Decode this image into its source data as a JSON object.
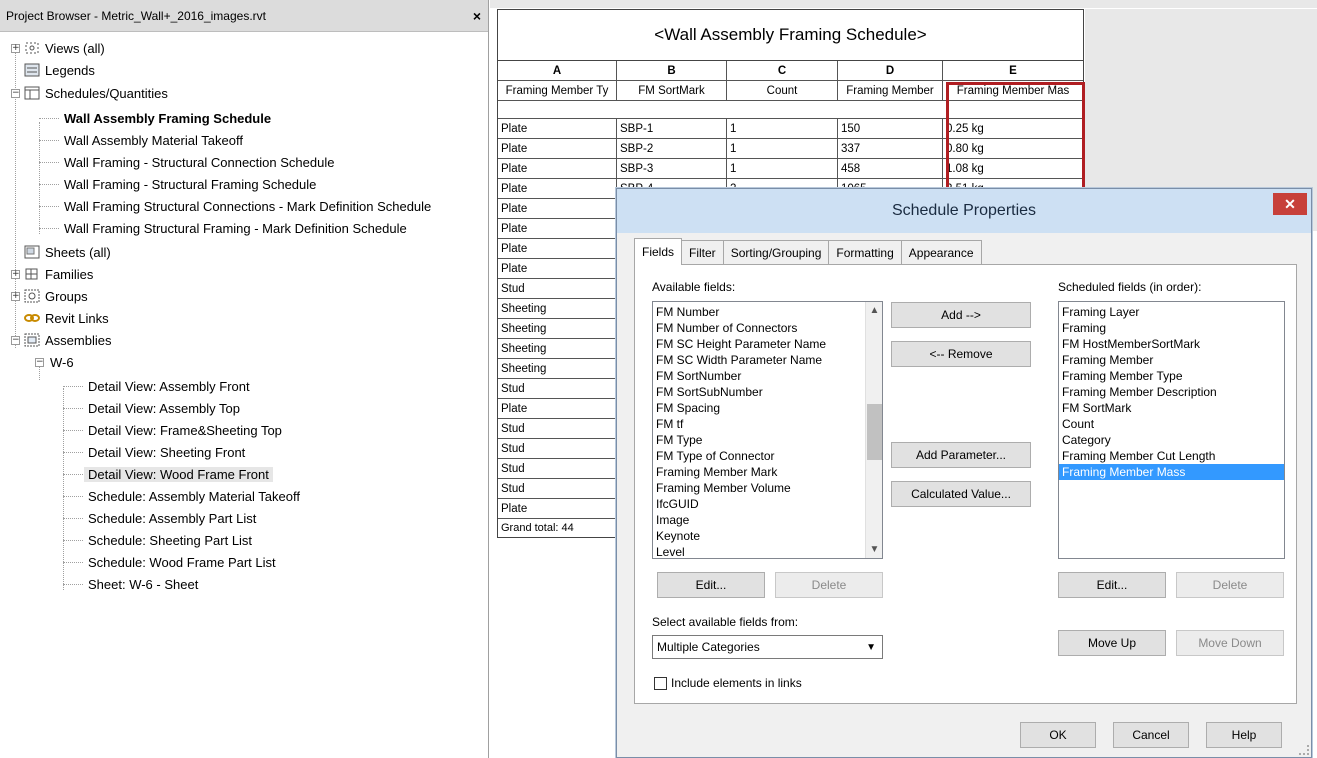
{
  "project_browser": {
    "title": "Project Browser - Metric_Wall+_2016_images.rvt",
    "close_glyph": "×",
    "tree": {
      "views": "Views (all)",
      "legends": "Legends",
      "schedules": "Schedules/Quantities",
      "schedule_items": [
        "Wall Assembly Framing Schedule",
        "Wall Assembly Material Takeoff",
        "Wall Framing - Structural Connection Schedule",
        "Wall Framing - Structural Framing Schedule",
        "Wall Framing Structural Connections - Mark  Definition Schedule",
        "Wall Framing Structural Framing - Mark  Definition Schedule"
      ],
      "sheets": "Sheets (all)",
      "families": "Families",
      "groups": "Groups",
      "revit_links": "Revit Links",
      "assemblies": "Assemblies",
      "assembly_name": "W-6",
      "assembly_items": [
        "Detail View: Assembly Front",
        "Detail View: Assembly Top",
        "Detail View: Frame&Sheeting Top",
        "Detail View: Sheeting Front",
        "Detail View: Wood Frame Front",
        "Schedule: Assembly Material Takeoff",
        "Schedule: Assembly Part List",
        "Schedule: Sheeting Part List",
        "Schedule: Wood Frame Part List",
        "Sheet: W-6 - Sheet"
      ],
      "selected_item": "Detail View: Wood Frame Front"
    }
  },
  "schedule": {
    "title": "<Wall Assembly Framing Schedule>",
    "letters": [
      "A",
      "B",
      "C",
      "D",
      "E"
    ],
    "headers": [
      "Framing Member Ty",
      "FM SortMark",
      "Count",
      "Framing Member",
      "Framing Member Mas"
    ],
    "rows": [
      [
        "Plate",
        "SBP-1",
        "1",
        "150",
        "0.25 kg"
      ],
      [
        "Plate",
        "SBP-2",
        "1",
        "337",
        "0.80 kg"
      ],
      [
        "Plate",
        "SBP-3",
        "1",
        "458",
        "1.08 kg"
      ],
      [
        "Plate",
        "SBP-4",
        "2",
        "1065",
        "2.51 kg"
      ],
      [
        "Plate",
        "",
        "",
        "",
        ""
      ],
      [
        "Plate",
        "",
        "",
        "",
        ""
      ],
      [
        "Plate",
        "",
        "",
        "",
        ""
      ],
      [
        "Plate",
        "",
        "",
        "",
        ""
      ],
      [
        "Stud",
        "",
        "",
        "",
        ""
      ],
      [
        "Sheeting",
        "",
        "",
        "",
        ""
      ],
      [
        "Sheeting",
        "",
        "",
        "",
        ""
      ],
      [
        "Sheeting",
        "",
        "",
        "",
        ""
      ],
      [
        "Sheeting",
        "",
        "",
        "",
        ""
      ],
      [
        "Stud",
        "",
        "",
        "",
        ""
      ],
      [
        "Plate",
        "",
        "",
        "",
        ""
      ],
      [
        "Stud",
        "",
        "",
        "",
        ""
      ],
      [
        "Stud",
        "",
        "",
        "",
        ""
      ],
      [
        "Stud",
        "",
        "",
        "",
        ""
      ],
      [
        "Stud",
        "",
        "",
        "",
        ""
      ],
      [
        "Plate",
        "",
        "",
        "",
        ""
      ]
    ],
    "grand_total": "Grand total: 44"
  },
  "dialog": {
    "title": "Schedule Properties",
    "close_glyph": "✕",
    "tabs": [
      "Fields",
      "Filter",
      "Sorting/Grouping",
      "Formatting",
      "Appearance"
    ],
    "available_label": "Available fields:",
    "available_fields": [
      "FM Number",
      "FM Number of Connectors",
      "FM SC Height Parameter Name",
      "FM SC Width Parameter Name",
      "FM SortNumber",
      "FM SortSubNumber",
      "FM Spacing",
      "FM tf",
      "FM Type",
      "FM Type of Connector",
      "Framing Member Mark",
      "Framing Member Volume",
      "IfcGUID",
      "Image",
      "Keynote",
      "Level"
    ],
    "scheduled_label": "Scheduled fields (in order):",
    "scheduled_fields": [
      "Framing Layer",
      "Framing",
      "FM HostMemberSortMark",
      "Framing Member",
      "Framing Member Type",
      "Framing Member Description",
      "FM SortMark",
      "Count",
      "Category",
      "Framing Member Cut Length",
      "Framing Member Mass"
    ],
    "selected_scheduled": "Framing Member Mass",
    "add_btn": "Add -->",
    "remove_btn": "<-- Remove",
    "add_param_btn": "Add Parameter...",
    "calc_value_btn": "Calculated Value...",
    "edit_left": "Edit...",
    "delete_left": "Delete",
    "edit_right": "Edit...",
    "delete_right": "Delete",
    "select_from_label": "Select available fields from:",
    "select_from_value": "Multiple Categories",
    "include_links": "Include elements in links",
    "move_up": "Move Up",
    "move_down": "Move Down",
    "ok": "OK",
    "cancel": "Cancel",
    "help": "Help"
  }
}
